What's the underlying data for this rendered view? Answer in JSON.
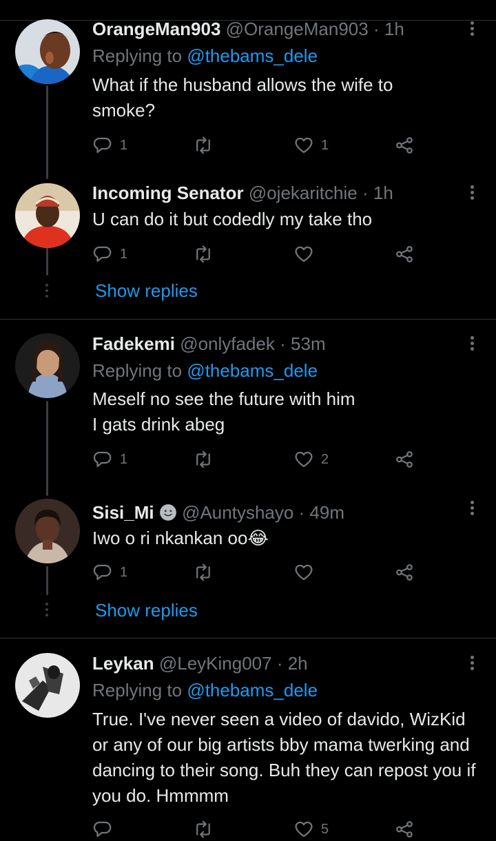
{
  "tweets": [
    {
      "name": "OrangeMan903",
      "handle": "@OrangeMan903",
      "dot": "·",
      "time": "1h",
      "replying_prefix": "Replying to",
      "replying_to": "@thebams_dele",
      "text": "What if the husband allows the wife to smoke?",
      "reply_count": "1",
      "retweet_count": "",
      "like_count": "1"
    },
    {
      "name": "Incoming Senator",
      "handle": "@ojekaritchie",
      "dot": "·",
      "time": "1h",
      "text": "U can do it but codedly my take tho",
      "reply_count": "1",
      "retweet_count": "",
      "like_count": "",
      "show_replies": "Show replies"
    },
    {
      "name": "Fadekemi",
      "handle": "@onlyfadek",
      "dot": "·",
      "time": "53m",
      "replying_prefix": "Replying to",
      "replying_to": "@thebams_dele",
      "text_line1": "Meself no see the future with him",
      "text_line2": "I gats drink abeg",
      "reply_count": "1",
      "retweet_count": "",
      "like_count": "2"
    },
    {
      "name": "Sisi_Mi",
      "handle": "@Auntyshayo",
      "dot": "·",
      "time": "49m",
      "text": "Iwo o ri nkankan oo😂",
      "reply_count": "1",
      "retweet_count": "",
      "like_count": "",
      "show_replies": "Show replies"
    },
    {
      "name": "Leykan",
      "handle": "@LeyKing007",
      "dot": "·",
      "time": "2h",
      "replying_prefix": "Replying to",
      "replying_to": "@thebams_dele",
      "text": "True. I've never seen a video of davido, WizKid or any of our big artists bby mama twerking and dancing to their song. Buh they can repost you if you do. Hmmmm",
      "reply_count": "",
      "retweet_count": "",
      "like_count": "5"
    }
  ],
  "icons": {
    "reply": "reply-icon",
    "retweet": "retweet-icon",
    "like": "heart-icon",
    "share": "share-icon",
    "more": "more-icon"
  },
  "colors": {
    "background": "#000000",
    "text": "#e7e9ea",
    "muted": "#71767b",
    "link": "#1d9bf0",
    "divider": "#2f3336"
  }
}
